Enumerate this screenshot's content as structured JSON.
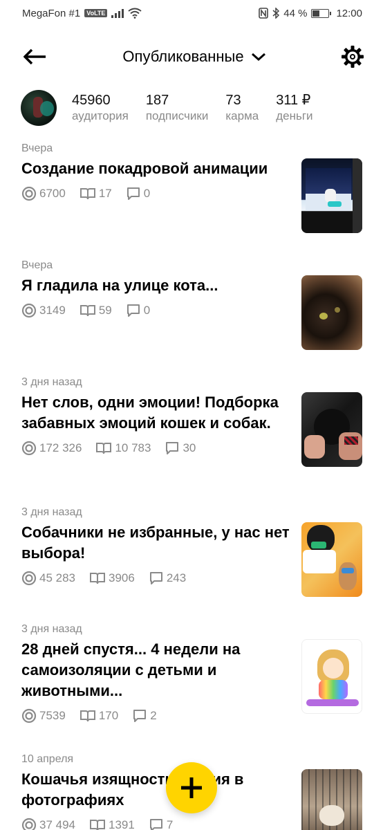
{
  "status_bar": {
    "carrier": "MegaFon #1",
    "volte": "VoLTE",
    "battery": "44 %",
    "battery_level": 0.44,
    "time": "12:00"
  },
  "header": {
    "title": "Опубликованные"
  },
  "stats": [
    {
      "value": "45960",
      "label": "аудитория"
    },
    {
      "value": "187",
      "label": "подписчики"
    },
    {
      "value": "73",
      "label": "карма"
    },
    {
      "value": "311 ₽",
      "label": "деньги"
    }
  ],
  "posts": [
    {
      "date": "Вчера",
      "title": "Создание покадровой анимации",
      "views": "6700",
      "reads": "17",
      "comments": "0"
    },
    {
      "date": "Вчера",
      "title": "Я гладила на улице кота...",
      "views": "3149",
      "reads": "59",
      "comments": "0"
    },
    {
      "date": "3 дня назад",
      "title": "Нет слов, одни эмоции! Подборка забавных эмоций кошек и собак.",
      "views": "172 326",
      "reads": "10 783",
      "comments": "30"
    },
    {
      "date": "3 дня назад",
      "title": "Собачники не избранные, у нас нет выбора!",
      "views": "45 283",
      "reads": "3906",
      "comments": "243"
    },
    {
      "date": "3 дня назад",
      "title": "28 дней спустя... 4 недели на самоизоляции с детьми и животными...",
      "views": "7539",
      "reads": "170",
      "comments": "2"
    },
    {
      "date": "10 апреля",
      "title": "Кошачья изящность грация в фотографиях",
      "views": "37 494",
      "reads": "1391",
      "comments": "7"
    }
  ],
  "icons": {
    "back": "arrow-left-icon",
    "dropdown": "chevron-down-icon",
    "settings": "gear-icon",
    "views": "eye-icon",
    "reads": "book-icon",
    "comments": "comment-icon",
    "add": "plus-icon"
  },
  "colors": {
    "accent": "#ffd400",
    "muted": "#8a8a8a"
  }
}
